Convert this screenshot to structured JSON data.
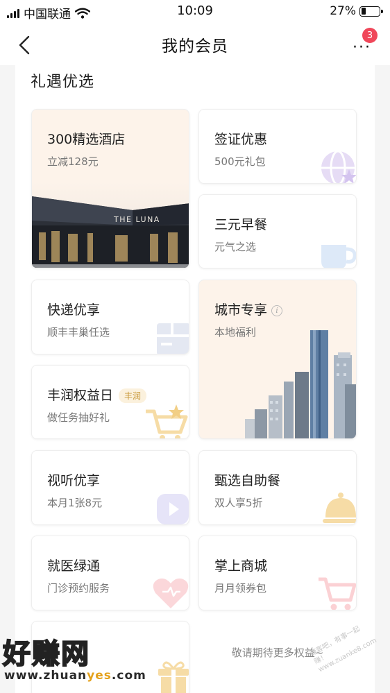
{
  "status_bar": {
    "carrier": "中国联通",
    "time": "10:09",
    "battery": "27%",
    "battery_level": 0.27
  },
  "nav": {
    "title": "我的会员",
    "more_icon": "ellipsis-icon",
    "badge_count": "3"
  },
  "section": {
    "title": "礼遇优选"
  },
  "cards": {
    "hotel": {
      "title": "300精选酒店",
      "subtitle": "立减128元",
      "image_text": "THE LUNA"
    },
    "visa": {
      "title": "签证优惠",
      "subtitle": "500元礼包",
      "icon": "globe-icon"
    },
    "breakfast": {
      "title": "三元早餐",
      "subtitle": "元气之选",
      "icon": "cup-icon"
    },
    "express": {
      "title": "快递优享",
      "subtitle": "顺丰丰巢任选",
      "icon": "parcel-icon"
    },
    "city": {
      "title": "城市专享",
      "subtitle": "本地福利",
      "icon": "info-icon"
    },
    "rights_day": {
      "title": "丰润权益日",
      "tag": "丰润",
      "subtitle": "做任务抽好礼",
      "icon": "cart-star-icon"
    },
    "av": {
      "title": "视听优享",
      "subtitle": "本月1张8元",
      "icon": "play-icon"
    },
    "buffet": {
      "title": "甄选自助餐",
      "subtitle": "双人享5折",
      "icon": "cloche-icon"
    },
    "medical": {
      "title": "就医绿通",
      "subtitle": "门诊预约服务",
      "icon": "heart-icon"
    },
    "mall": {
      "title": "掌上商城",
      "subtitle": "月月领券包",
      "icon": "cart-icon"
    },
    "gift": {
      "icon": "gift-icon"
    }
  },
  "more_note": "敬请期待更多权益~",
  "watermark": {
    "big": "好赚网",
    "small_a": "www.zhuan",
    "small_b": "yes",
    "small_c": ".com",
    "stamp": "赚客吧，有事一起赚！ www.zuanke8.com"
  },
  "colors": {
    "badge": "#f0475a",
    "tag_text": "#c99a3c",
    "tag_bg": "#fbf1dd",
    "warm_card_bg": "#fdf3ea"
  }
}
